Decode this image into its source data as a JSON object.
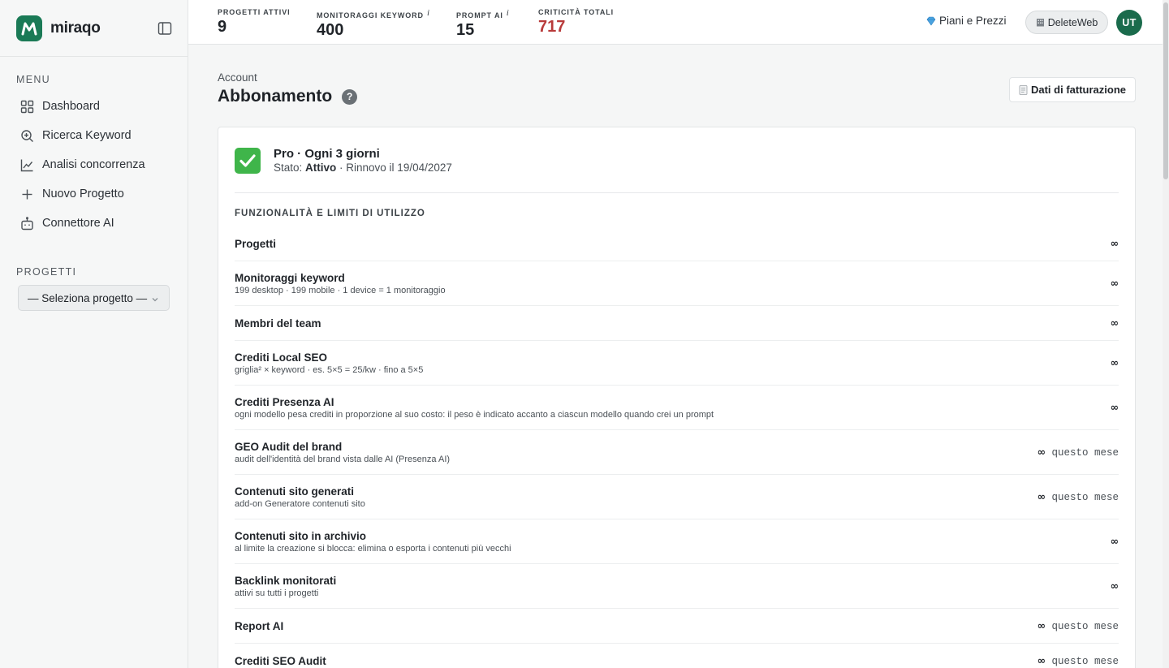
{
  "brand": {
    "name": "miraqo",
    "logo_letter": "M"
  },
  "sidebar": {
    "menu_label": "MENU",
    "items": [
      {
        "label": "Dashboard",
        "icon": "grid-icon"
      },
      {
        "label": "Ricerca Keyword",
        "icon": "search-plus-icon"
      },
      {
        "label": "Analisi concorrenza",
        "icon": "line-chart-icon"
      },
      {
        "label": "Nuovo Progetto",
        "icon": "plus-icon"
      },
      {
        "label": "Connettore AI",
        "icon": "robot-icon"
      }
    ],
    "projects_label": "PROGETTI",
    "project_select": "— Seleziona progetto —"
  },
  "topbar": {
    "stats": [
      {
        "label": "PROGETTI ATTIVI",
        "value": "9",
        "info": ""
      },
      {
        "label": "MONITORAGGI KEYWORD",
        "value": "400",
        "info": "i"
      },
      {
        "label": "PROMPT AI",
        "value": "15",
        "info": "i"
      },
      {
        "label": "CRITICITÀ TOTALI",
        "value": "717",
        "info": ""
      }
    ],
    "pricing_label": "Piani e Prezzi",
    "workspace_label": "DeleteWeb",
    "avatar_initials": "UT"
  },
  "page": {
    "breadcrumb": "Account",
    "title": "Abbonamento",
    "help": "?",
    "billing_button": "Dati di fatturazione"
  },
  "plan": {
    "name": "Pro · Ogni 3 giorni",
    "status_prefix": "Stato: ",
    "status": "Attivo",
    "renewal": " · Rinnovo il 19/04/2027"
  },
  "features": {
    "title": "FUNZIONALITÀ E LIMITI DI UTILIZZO",
    "rows": [
      {
        "name": "Progetti",
        "desc": "",
        "value": "∞",
        "suffix": ""
      },
      {
        "name": "Monitoraggi keyword",
        "desc": "199 desktop · 199 mobile · 1 device = 1 monitoraggio",
        "value": "∞",
        "suffix": ""
      },
      {
        "name": "Membri del team",
        "desc": "",
        "value": "∞",
        "suffix": ""
      },
      {
        "name": "Crediti Local SEO",
        "desc": "griglia² × keyword · es. 5×5 = 25/kw · fino a 5×5",
        "value": "∞",
        "suffix": ""
      },
      {
        "name": "Crediti Presenza AI",
        "desc": "ogni modello pesa crediti in proporzione al suo costo: il peso è indicato accanto a ciascun modello quando crei un prompt",
        "value": "∞",
        "suffix": ""
      },
      {
        "name": "GEO Audit del brand",
        "desc": "audit dell'identità del brand vista dalle AI (Presenza AI)",
        "value": "∞",
        "suffix": " questo mese"
      },
      {
        "name": "Contenuti sito generati",
        "desc": "add-on Generatore contenuti sito",
        "value": "∞",
        "suffix": " questo mese"
      },
      {
        "name": "Contenuti sito in archivio",
        "desc": "al limite la creazione si blocca: elimina o esporta i contenuti più vecchi",
        "value": "∞",
        "suffix": ""
      },
      {
        "name": "Backlink monitorati",
        "desc": "attivi su tutti i progetti",
        "value": "∞",
        "suffix": ""
      },
      {
        "name": "Report AI",
        "desc": "",
        "value": "∞",
        "suffix": " questo mese"
      },
      {
        "name": "Crediti SEO Audit",
        "desc": "",
        "value": "∞",
        "suffix": " questo mese"
      }
    ]
  },
  "colors": {
    "brand": "#1a7a56",
    "critical": "#b83a3a",
    "check": "#3fb54a"
  }
}
